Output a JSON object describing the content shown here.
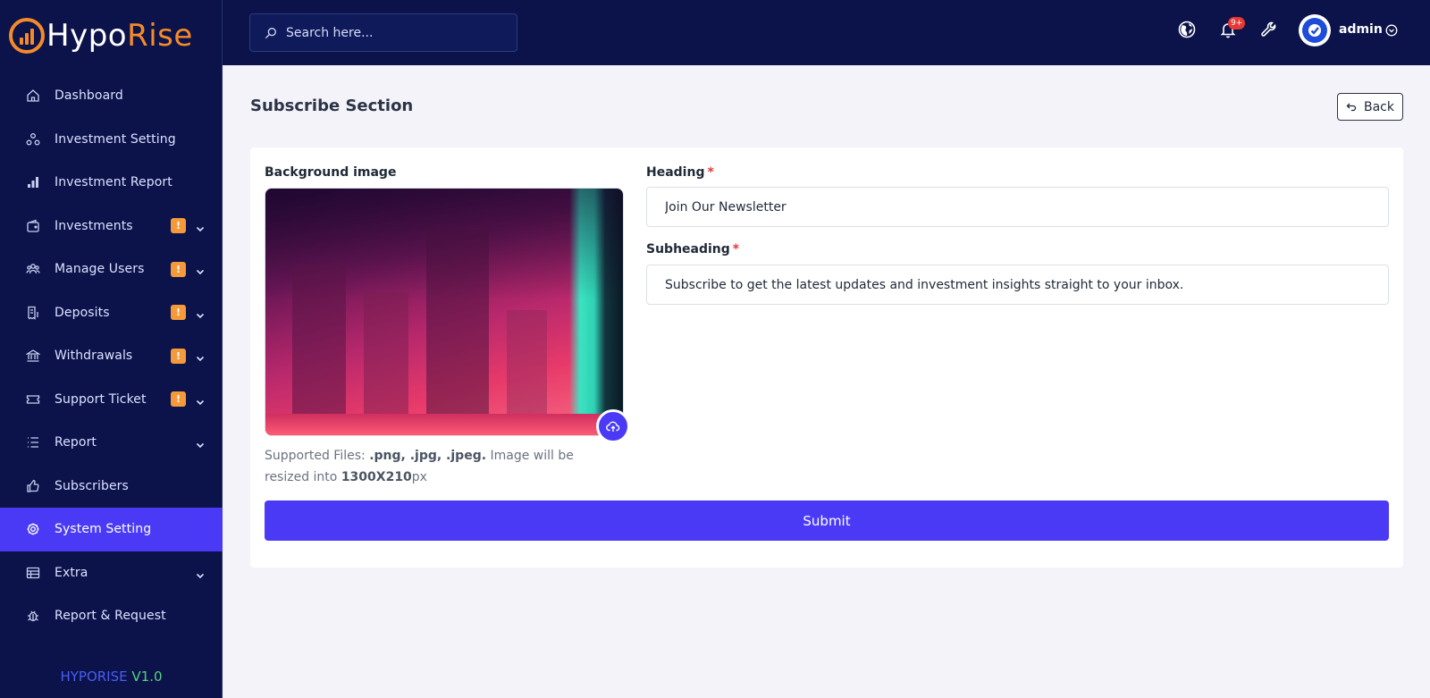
{
  "brand": {
    "name_a": "Hypo",
    "name_b": "Rise",
    "accent": "#f48a2a"
  },
  "sidebar": {
    "items": [
      {
        "label": "Dashboard",
        "icon": "home-icon"
      },
      {
        "label": "Investment Setting",
        "icon": "network-icon"
      },
      {
        "label": "Investment Report",
        "icon": "bar-chart-icon"
      },
      {
        "label": "Investments",
        "icon": "wallet-icon",
        "badge": "!",
        "chevron": true
      },
      {
        "label": "Manage Users",
        "icon": "users-icon",
        "badge": "!",
        "chevron": true
      },
      {
        "label": "Deposits",
        "icon": "receipt-icon",
        "badge": "!",
        "chevron": true
      },
      {
        "label": "Withdrawals",
        "icon": "bank-icon",
        "badge": "!",
        "chevron": true
      },
      {
        "label": "Support Ticket",
        "icon": "ticket-icon",
        "badge": "!",
        "chevron": true
      },
      {
        "label": "Report",
        "icon": "list-icon",
        "chevron": true
      },
      {
        "label": "Subscribers",
        "icon": "thumbs-up-icon"
      },
      {
        "label": "System Setting",
        "icon": "settings-icon",
        "active": true
      },
      {
        "label": "Extra",
        "icon": "table-icon",
        "chevron": true
      },
      {
        "label": "Report & Request",
        "icon": "bug-icon"
      }
    ],
    "version_name": "HYPORISE",
    "version_number": "V1.0"
  },
  "topbar": {
    "search_placeholder": "Search here...",
    "notification_count": "9+",
    "user_name": "admin"
  },
  "main": {
    "title": "Subscribe Section",
    "back_label": "Back",
    "background_image_label": "Background image",
    "help_prefix": "Supported Files: ",
    "help_types": ".png, .jpg, .jpeg.",
    "help_mid": " Image will be resized into ",
    "help_size": "1300X210",
    "help_unit": "px",
    "heading_label": "Heading",
    "heading_value": "Join Our Newsletter",
    "subheading_label": "Subheading",
    "subheading_value": "Subscribe to get the latest updates and investment insights straight to your inbox.",
    "required_mark": "*",
    "submit_label": "Submit"
  }
}
